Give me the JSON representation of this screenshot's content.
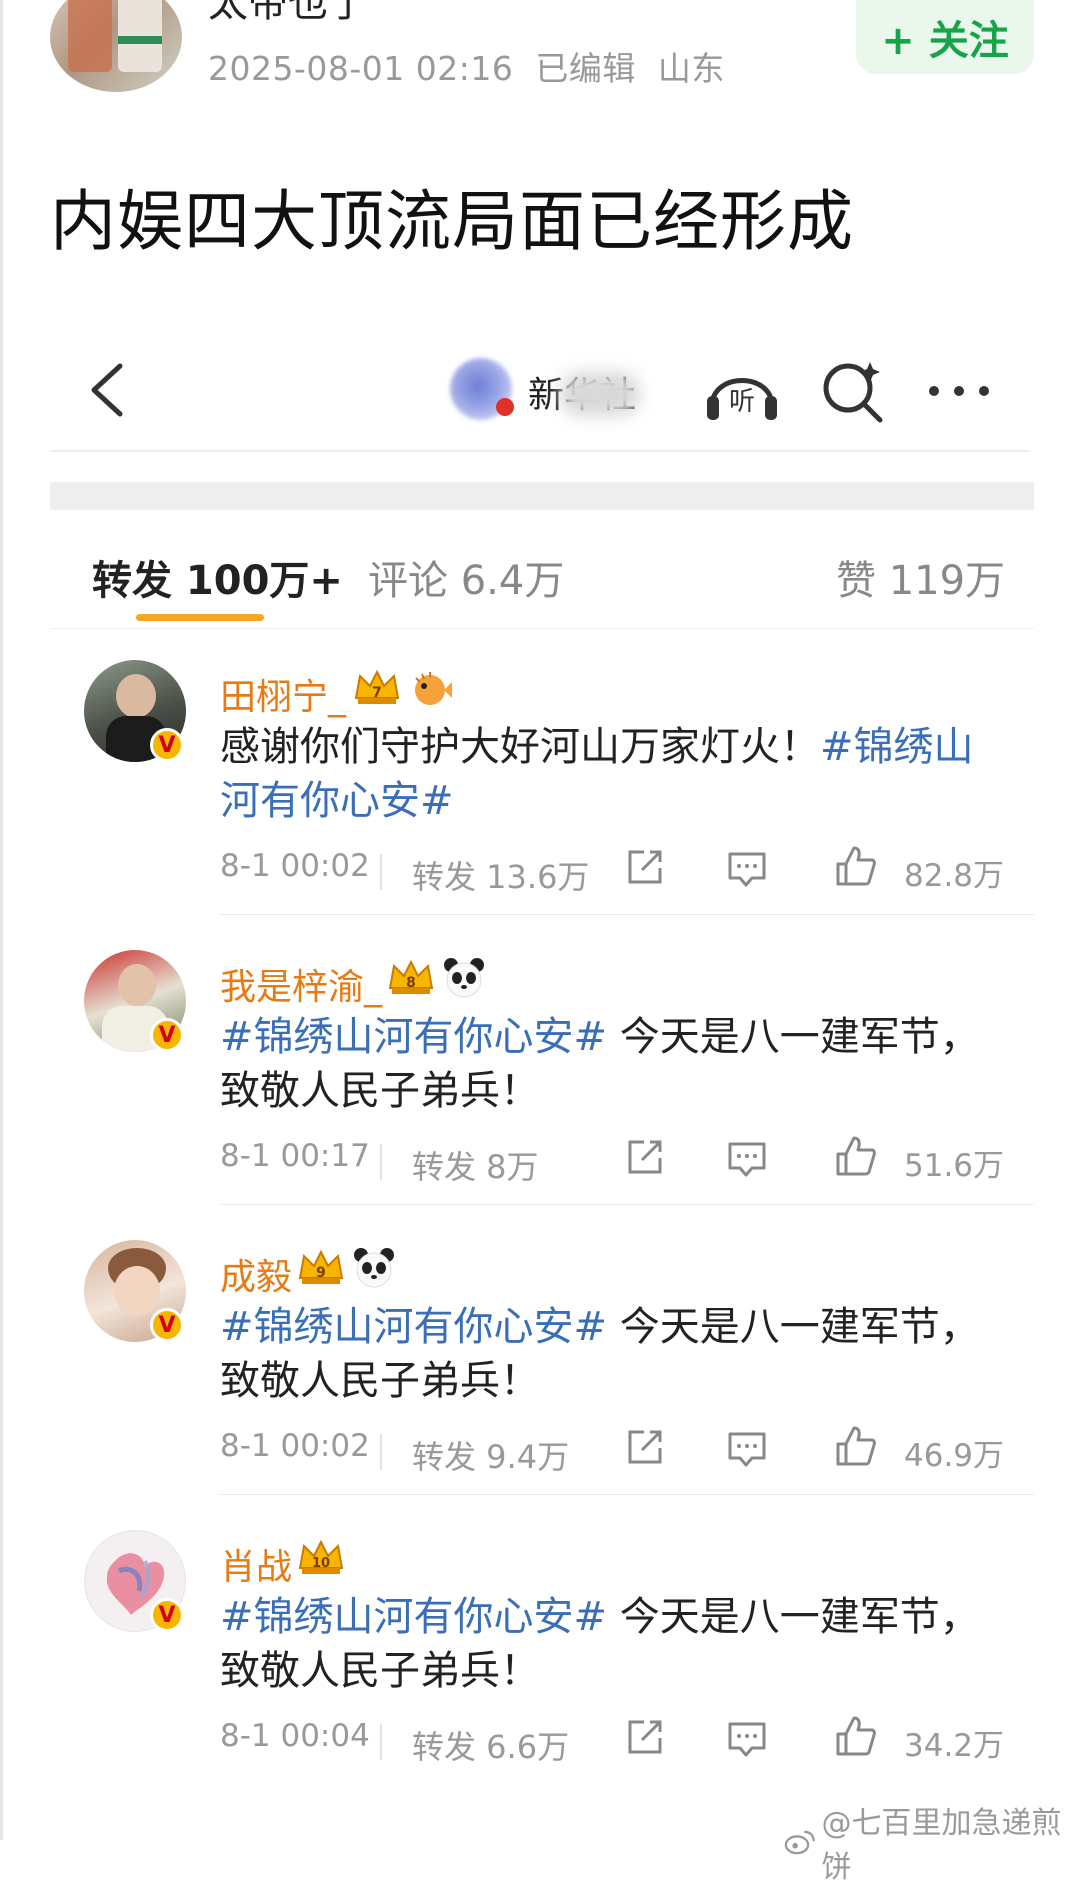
{
  "post": {
    "author": "太帝也了",
    "time": "2025-08-01 02:16",
    "edited": "已编辑",
    "location": "山东",
    "follow_label": "+ 关注",
    "title": "内娱四大顶流局面已经形成"
  },
  "embedded": {
    "nav_name": "新华社",
    "listen_label": "听",
    "tabs": {
      "repost": "转发 100万+",
      "comment": "评论 6.4万",
      "like": "赞 119万"
    },
    "items": [
      {
        "name": "田栩宁_",
        "crown_level": "7",
        "content_parts": [
          "感谢你们守护大好河山万家灯火！",
          "#锦绣山河有你心安#"
        ],
        "time": "8-1 00:02",
        "repost": "转发 13.6万",
        "likes": "82.8万"
      },
      {
        "name": "我是梓渝_",
        "crown_level": "8",
        "content_parts": [
          "#锦绣山河有你心安#",
          " 今天是八一建军节，致敬人民子弟兵！"
        ],
        "time": "8-1 00:17",
        "repost": "转发 8万",
        "likes": "51.6万"
      },
      {
        "name": "成毅",
        "crown_level": "9",
        "content_parts": [
          "#锦绣山河有你心安#",
          " 今天是八一建军节，致敬人民子弟兵！"
        ],
        "time": "8-1 00:02",
        "repost": "转发 9.4万",
        "likes": "46.9万"
      },
      {
        "name": "肖战",
        "crown_level": "10",
        "content_parts": [
          "#锦绣山河有你心安#",
          " 今天是八一建军节，致敬人民子弟兵！"
        ],
        "time": "8-1 00:04",
        "repost": "转发 6.6万",
        "likes": "34.2万"
      }
    ]
  },
  "watermark": "@七百里加急递煎饼",
  "verified_mark": "V",
  "colors": {
    "accent_orange": "#f5a623",
    "name_orange": "#e87a12",
    "topic_blue": "#3a6fb7",
    "follow_green": "#17a34a"
  }
}
